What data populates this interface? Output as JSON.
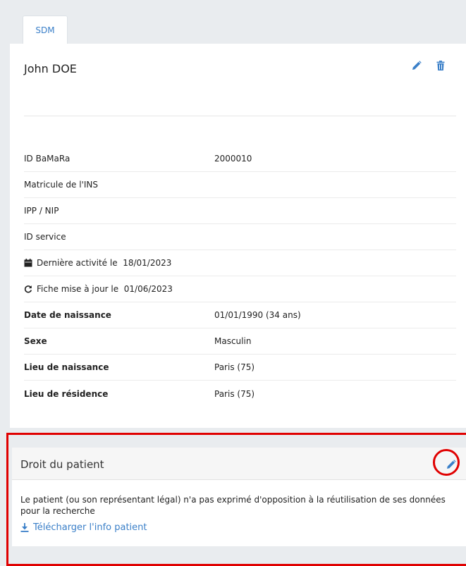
{
  "tabs": [
    {
      "label": "SDM"
    }
  ],
  "patient": {
    "name": "John DOE",
    "fields": [
      {
        "label": "ID BaMaRa",
        "value": "2000010"
      },
      {
        "label": "Matricule de l'INS",
        "value": ""
      },
      {
        "label": "IPP / NIP",
        "value": ""
      },
      {
        "label": "ID service",
        "value": ""
      },
      {
        "icon": "calendar-icon",
        "label": "Dernière activité le  18/01/2023",
        "value": ""
      },
      {
        "icon": "refresh-icon",
        "label": "Fiche mise à jour le  01/06/2023",
        "value": ""
      },
      {
        "label": "Date de naissance",
        "value": "01/01/1990 (34 ans)"
      },
      {
        "label": "Sexe",
        "value": "Masculin"
      },
      {
        "label": "Lieu de naissance",
        "value": "Paris (75)"
      },
      {
        "label": "Lieu de résidence",
        "value": "Paris (75)"
      }
    ]
  },
  "rights": {
    "title": "Droit du patient",
    "text": "Le patient (ou son représentant légal) n'a pas exprimé d'opposition à la réutilisation de ses données pour la recherche",
    "download_label": "Télécharger l'info patient"
  },
  "colors": {
    "accent": "#3a7fc8",
    "highlight": "#e00000"
  }
}
